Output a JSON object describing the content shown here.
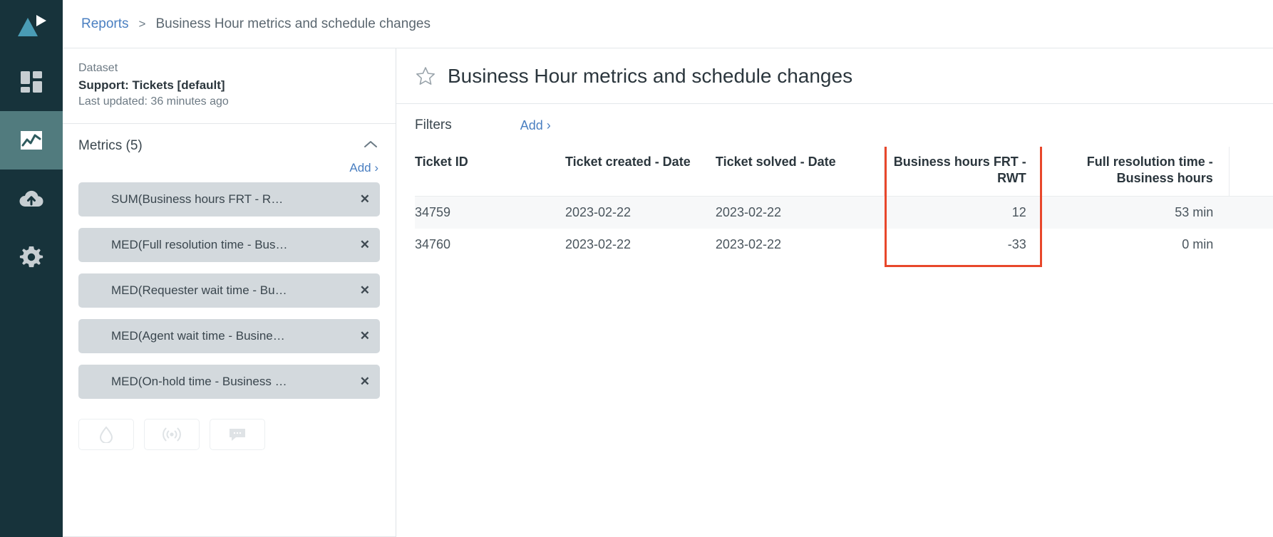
{
  "rail": {
    "logo_icon": "triangle-play-logo",
    "items": [
      {
        "icon": "dashboard-grid-icon",
        "name": "dashboards",
        "active": false
      },
      {
        "icon": "line-chart-icon",
        "name": "reports",
        "active": true
      },
      {
        "icon": "cloud-upload-icon",
        "name": "uploads",
        "active": false
      },
      {
        "icon": "gear-icon",
        "name": "settings",
        "active": false
      }
    ]
  },
  "breadcrumb": {
    "root": "Reports",
    "separator": ">",
    "current": "Business Hour metrics and schedule changes"
  },
  "panel": {
    "dataset": {
      "label": "Dataset",
      "name": "Support: Tickets [default]",
      "updated": "Last updated: 36 minutes ago"
    },
    "metrics": {
      "title": "Metrics (5)",
      "collapse_icon": "chevron-up-icon",
      "add_label": "Add ›",
      "remove_icon": "close-icon",
      "items": [
        {
          "label": "SUM(Business hours FRT - R…"
        },
        {
          "label": "MED(Full resolution time - Bus…"
        },
        {
          "label": "MED(Requester wait time - Bu…"
        },
        {
          "label": "MED(Agent wait time - Busine…"
        },
        {
          "label": "MED(On-hold time - Business …"
        }
      ]
    },
    "tools": [
      {
        "icon": "droplet-icon",
        "name": "formula-tool"
      },
      {
        "icon": "broadcast-icon",
        "name": "alerts-tool"
      },
      {
        "icon": "comment-icon",
        "name": "comments-tool"
      }
    ]
  },
  "report": {
    "star_icon": "star-outline-icon",
    "title": "Business Hour metrics and schedule changes",
    "filters": {
      "label": "Filters",
      "add_label": "Add ›"
    }
  },
  "table_data": {
    "type": "table",
    "columns": [
      {
        "header": "Ticket ID",
        "align": "left"
      },
      {
        "header": "Ticket created - Date",
        "align": "left"
      },
      {
        "header": "Ticket solved - Date",
        "align": "left"
      },
      {
        "header": "Business hours FRT - RWT",
        "align": "right",
        "highlighted": true
      },
      {
        "header": "Full resolution time - Business hours",
        "align": "right"
      }
    ],
    "rows": [
      {
        "striped": true,
        "cells": [
          "34759",
          "2023-02-22",
          "2023-02-22",
          "12",
          "53 min"
        ]
      },
      {
        "striped": false,
        "cells": [
          "34760",
          "2023-02-22",
          "2023-02-22",
          "-33",
          "0 min"
        ]
      }
    ]
  },
  "colors": {
    "rail_bg": "#17333b",
    "rail_active": "#517b7e",
    "link": "#4a7fc1",
    "highlight_border": "#e8472b",
    "chip_bg": "#d3d9dd",
    "logo_accent": "#4a9cb5"
  }
}
